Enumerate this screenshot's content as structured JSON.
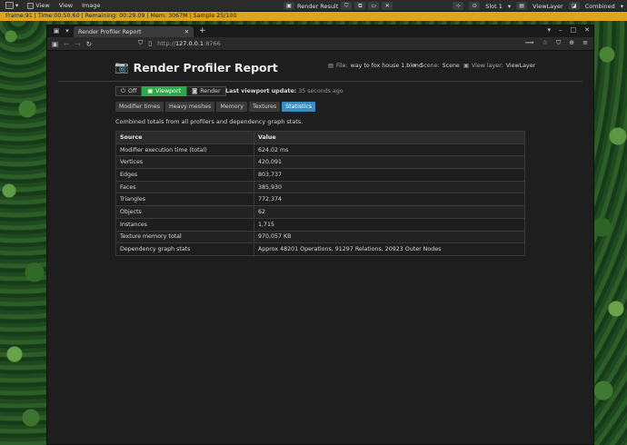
{
  "blender": {
    "menu": [
      "View",
      "View",
      "Image"
    ],
    "image_name": "Render Result",
    "slot": "Slot 1",
    "view_layer": "ViewLayer",
    "pass": "Combined",
    "status": "Frame:91 | Time:00:50.60 | Remaining: 00:29.09 | Mem: 3067M | Sample 25/100"
  },
  "browser": {
    "tab_title": "Render Profiler Report",
    "url_scheme": "http://",
    "url_host": "127.0.0.1",
    "url_port": ":8766"
  },
  "report": {
    "title": "Render Profiler Report",
    "file_label": "File:",
    "file_value": "way to fox house 1.blend",
    "scene_label": "Scene:",
    "scene_value": "Scene",
    "view_layer_label": "View layer:",
    "view_layer_value": "ViewLayer",
    "modes": {
      "off": "Off",
      "viewport": "Viewport",
      "render": "Render"
    },
    "last_update_label": "Last viewport update:",
    "last_update_value": "35 seconds ago",
    "subtabs": [
      "Modifier times",
      "Heavy meshes",
      "Memory",
      "Textures",
      "Statistics"
    ],
    "active_subtab": "Statistics",
    "summary": "Combined totals from all profilers and dependency graph stats.",
    "table": {
      "headers": [
        "Source",
        "Value"
      ],
      "rows": [
        [
          "Modifier execution time (total)",
          "624.02 ms"
        ],
        [
          "Vertices",
          "420,091"
        ],
        [
          "Edges",
          "803,737"
        ],
        [
          "Faces",
          "385,930"
        ],
        [
          "Triangles",
          "772,374"
        ],
        [
          "Objects",
          "62"
        ],
        [
          "Instances",
          "1,715"
        ],
        [
          "Texture memory total",
          "970,057 KB"
        ],
        [
          "Dependency graph stats",
          "Approx 48201 Operations, 91297 Relations, 20923 Outer Nodes"
        ]
      ]
    }
  },
  "colors": {
    "status_bar": "#e1a31b",
    "viewport_active": "#2da84a",
    "subtab_active": "#3b8ec4"
  }
}
